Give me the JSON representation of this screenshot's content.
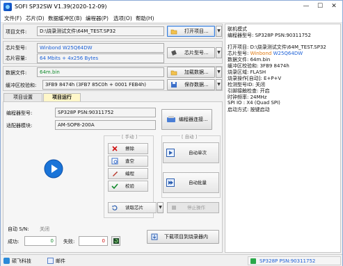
{
  "window": {
    "title": "SOFI SP32SW V1.39(2020-12-09)",
    "minimize": "—",
    "maximize": "☐",
    "close": "✕"
  },
  "menu": [
    "文件(F)",
    "芯片(D)",
    "数据缓冲区(B)",
    "编程器(P)",
    "选项(O)",
    "帮助(H)"
  ],
  "project": {
    "label": "项目文件:",
    "value": "D:\\烧录测试文件\\64M_TEST.SP32",
    "open_button": "打开项目..."
  },
  "chip": {
    "model_label": "芯片型号:",
    "model_value": "Winbond W25Q64DW",
    "capacity_label": "芯片容量:",
    "capacity_value": "64 Mbits + 4x256 Bytes",
    "select_button": "芯片型号..."
  },
  "data": {
    "file_label": "数据文件:",
    "file_value": "64m.bin",
    "load_button": "加载数据...",
    "checksum_label": "缓冲区校验和:",
    "checksum_value": "3FB9 8474h (3FB7 85C0h + 0001 FEB4h)",
    "save_button": "保存数据..."
  },
  "tabs": {
    "settings": "项目设置",
    "run": "项目运行"
  },
  "programmer": {
    "model_label": "编程器型号:",
    "model_value": "SP328P  PSN:90311752",
    "adapter_label": "适配器模块:",
    "adapter_value": "AM-SOP8-200A",
    "connect_button": "编程器连接..."
  },
  "manual": {
    "title": "[ 手动 ]",
    "erase": "擦除",
    "blank_check": "查空",
    "program": "编程",
    "verify": "校验",
    "read_chip": "读取芯片"
  },
  "auto": {
    "title": "[ 自动 ]",
    "auto_single": "自动单次",
    "auto_batch": "自动批量",
    "stop": "停止操作"
  },
  "counters": {
    "auto_sn_label": "自动 S/N:",
    "auto_sn_value": "关闭",
    "success_label": "成功:",
    "success_value": "0",
    "fail_label": "失败:",
    "fail_value": "0"
  },
  "download_button": "下载项目到烧录器内",
  "log": {
    "lines": [
      "联机模式",
      "编程器型号: SP328P  PSN:90311752",
      "",
      "打开项目: D:\\烧录测试文件\\64M_TEST.SP32",
      "芯片型号: Winbond   W25Q64DW",
      "数据文件: 64m.bin",
      "缓冲区校验和: 3FB9 8474h",
      "烧录区域: FLASH",
      "烧录操作[自动]: E+P+V",
      "检测型号ID: 关闭",
      "引脚接触检查: 开启",
      "时钟频率: 24MHz",
      "SPI IO : X4 (Quad SPI)",
      "启动方式: 按键启动"
    ]
  },
  "status": {
    "company": "硕飞科技",
    "email": "邮件",
    "device": "SP328P  PSN:90311752"
  },
  "colors": {
    "accent_blue": "#1a5fd6",
    "accent_orange": "#e07a10",
    "success_green": "#108a2a",
    "fail_red": "#d01010"
  }
}
